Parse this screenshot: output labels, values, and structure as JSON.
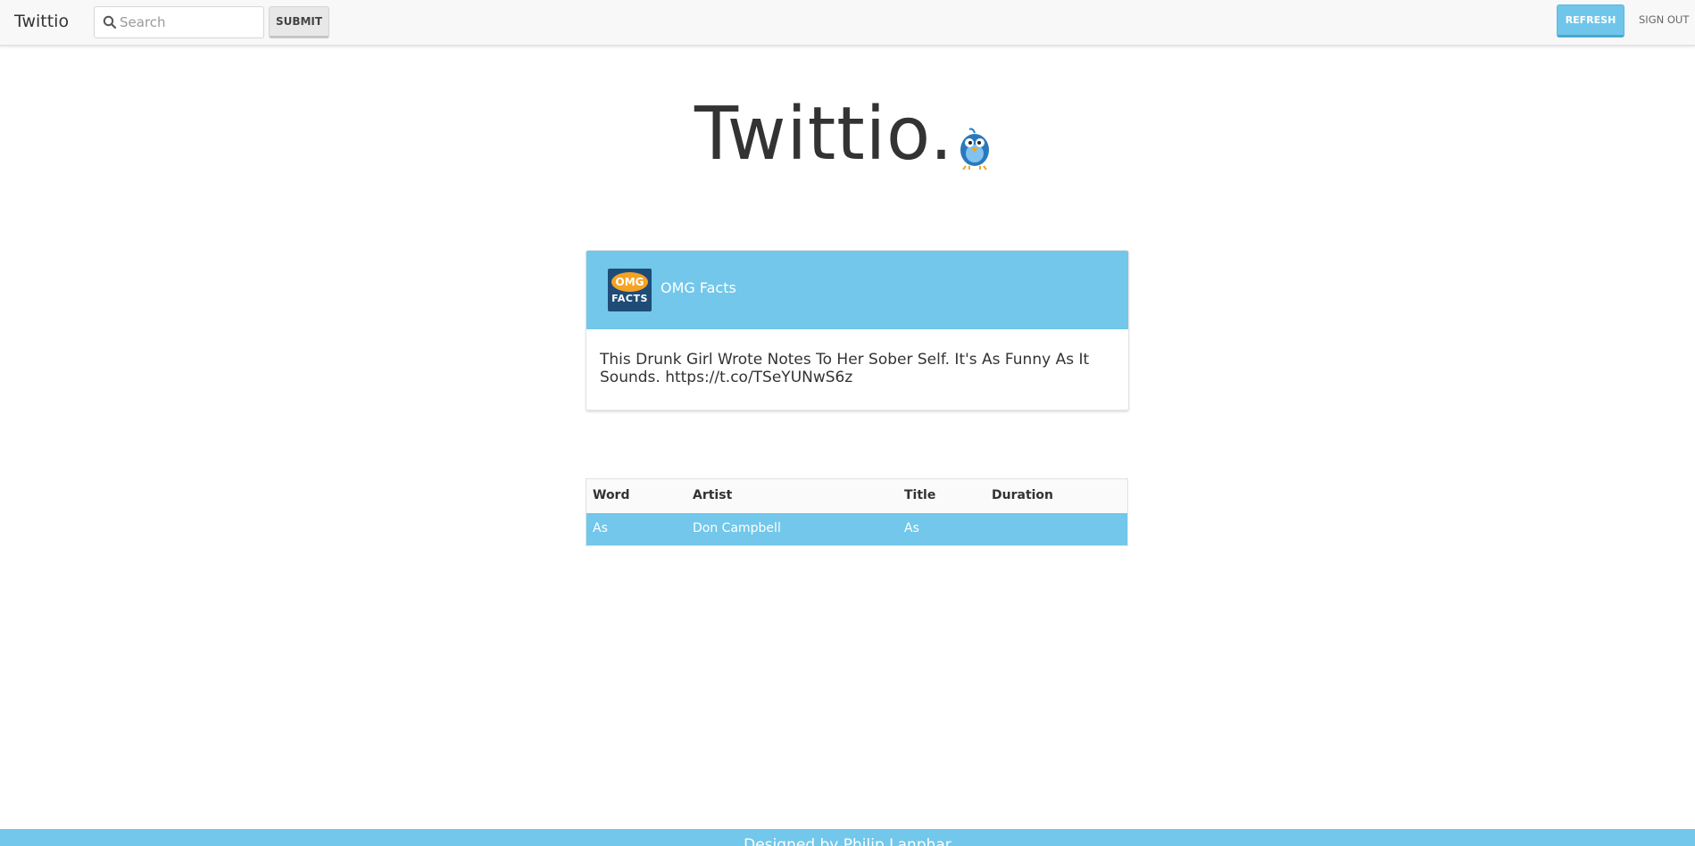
{
  "navbar": {
    "brand": "Twittio",
    "search": {
      "placeholder": "Search",
      "value": ""
    },
    "submit_label": "SUBMIT",
    "refresh_label": "REFRESH",
    "signout_label": "SIGN OUT"
  },
  "logo": {
    "title": "Twittio.",
    "bird_icon": "twitter-bird-icon"
  },
  "tweet": {
    "author": "OMG Facts",
    "avatar": {
      "top": "OMG",
      "bottom": "FACTS"
    },
    "text": "This Drunk Girl Wrote Notes To Her Sober Self. It's As Funny As It Sounds. https://t.co/TSeYUNwS6z"
  },
  "table": {
    "headers": [
      "Word",
      "Artist",
      "Title",
      "Duration"
    ],
    "rows": [
      [
        "As",
        "Don Campbell",
        "As",
        ""
      ]
    ]
  },
  "footer": {
    "text": "Designed by Philip Lanphar"
  },
  "colors": {
    "accent": "#72c7ea",
    "navbar_bg": "#f8f8f8",
    "text": "#333333"
  }
}
